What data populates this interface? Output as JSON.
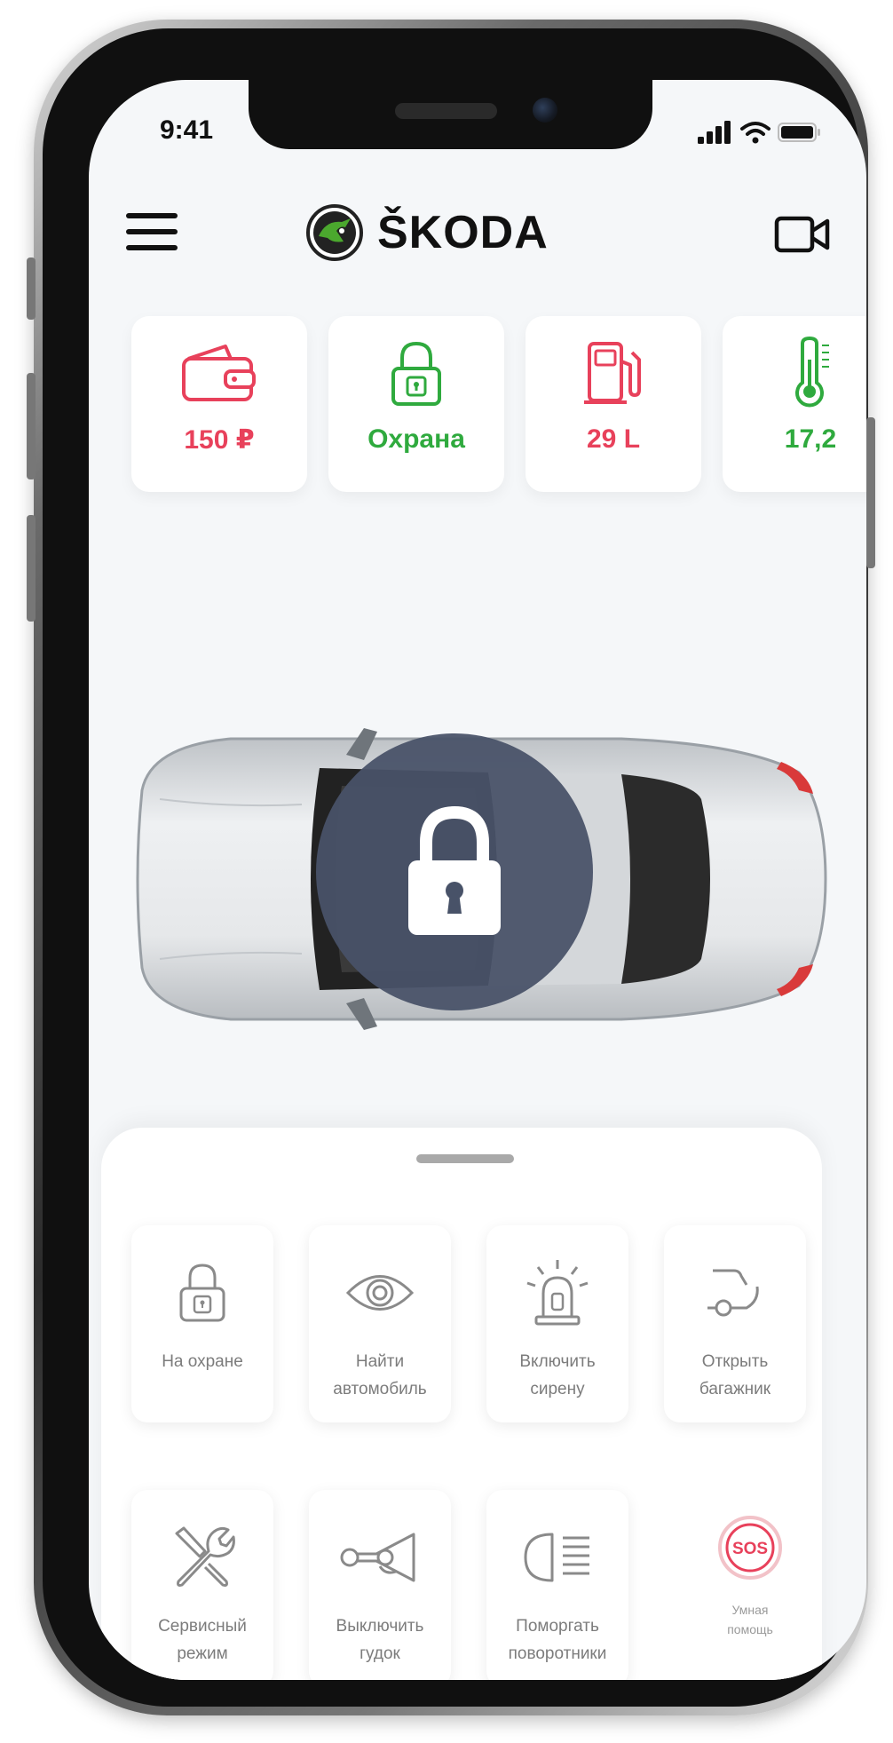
{
  "status_bar": {
    "time": "9:41"
  },
  "header": {
    "brand": "ŠKODA"
  },
  "status_cards": [
    {
      "value": "150 ₽",
      "color": "#e8415b"
    },
    {
      "value": "Охрана",
      "color": "#2faa3e"
    },
    {
      "value": "29 L",
      "color": "#e8415b"
    },
    {
      "value": "17,2",
      "color": "#2faa3e"
    }
  ],
  "actions": [
    {
      "label": "На охране"
    },
    {
      "label": "Найти\nавтомобиль"
    },
    {
      "label": "Включить\nсирену"
    },
    {
      "label": "Открыть\nбагажник"
    },
    {
      "label": "Сервисный\nрежим"
    },
    {
      "label": "Выключить\nгудок"
    },
    {
      "label": "Поморгать\nповоротники"
    }
  ],
  "sos": {
    "badge": "SOS",
    "label": "Умная\nпомощь"
  },
  "colors": {
    "accent_red": "#e8415b",
    "accent_green": "#2faa3e",
    "lock_overlay": "#485268",
    "icon_gray": "#8a8a8a"
  }
}
